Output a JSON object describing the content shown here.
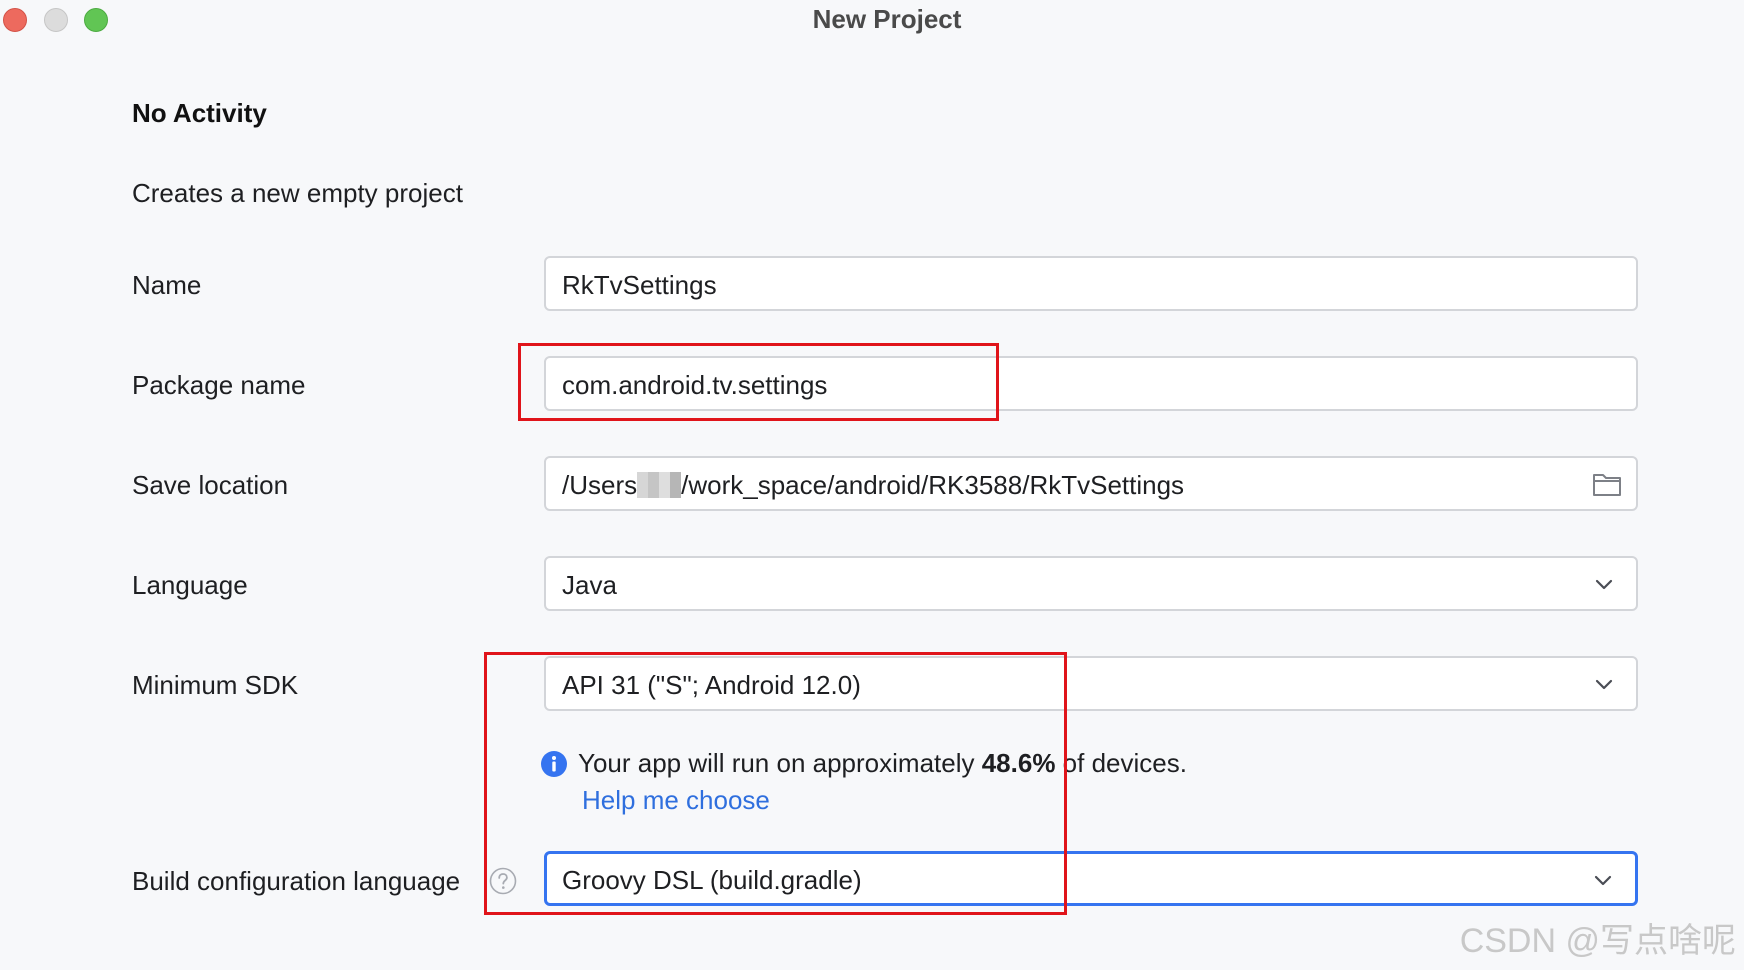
{
  "window": {
    "title": "New Project"
  },
  "header": {
    "title": "No Activity",
    "description": "Creates a new empty project"
  },
  "form": {
    "name": {
      "label": "Name",
      "value": "RkTvSettings"
    },
    "package_name": {
      "label": "Package name",
      "value": "com.android.tv.settings"
    },
    "save_location": {
      "label": "Save location",
      "value_prefix": "/Users",
      "value_suffix": "/work_space/android/RK3588/RkTvSettings",
      "icon": "folder-icon"
    },
    "language": {
      "label": "Language",
      "value": "Java",
      "icon": "chevron-down-icon"
    },
    "minimum_sdk": {
      "label": "Minimum SDK",
      "value": "API 31 (\"S\"; Android 12.0)",
      "icon": "chevron-down-icon"
    },
    "sdk_info": {
      "icon": "info-icon",
      "text_before": "Your app will run on approximately ",
      "percentage": "48.6%",
      "text_after": " of devices.",
      "link": "Help me choose"
    },
    "build_config_language": {
      "label": "Build configuration language",
      "help_icon": "question-icon",
      "value": "Groovy DSL (build.gradle)",
      "icon": "chevron-down-icon"
    }
  },
  "watermark": "CSDN @写点啥呢",
  "colors": {
    "background": "#f7f8fa",
    "field_border": "#d3d5d9",
    "focus_border": "#3574f0",
    "link": "#2f6fde",
    "annotation_red": "#e0141a",
    "close_button": "#ed6a5e",
    "zoom_button": "#61c554"
  }
}
